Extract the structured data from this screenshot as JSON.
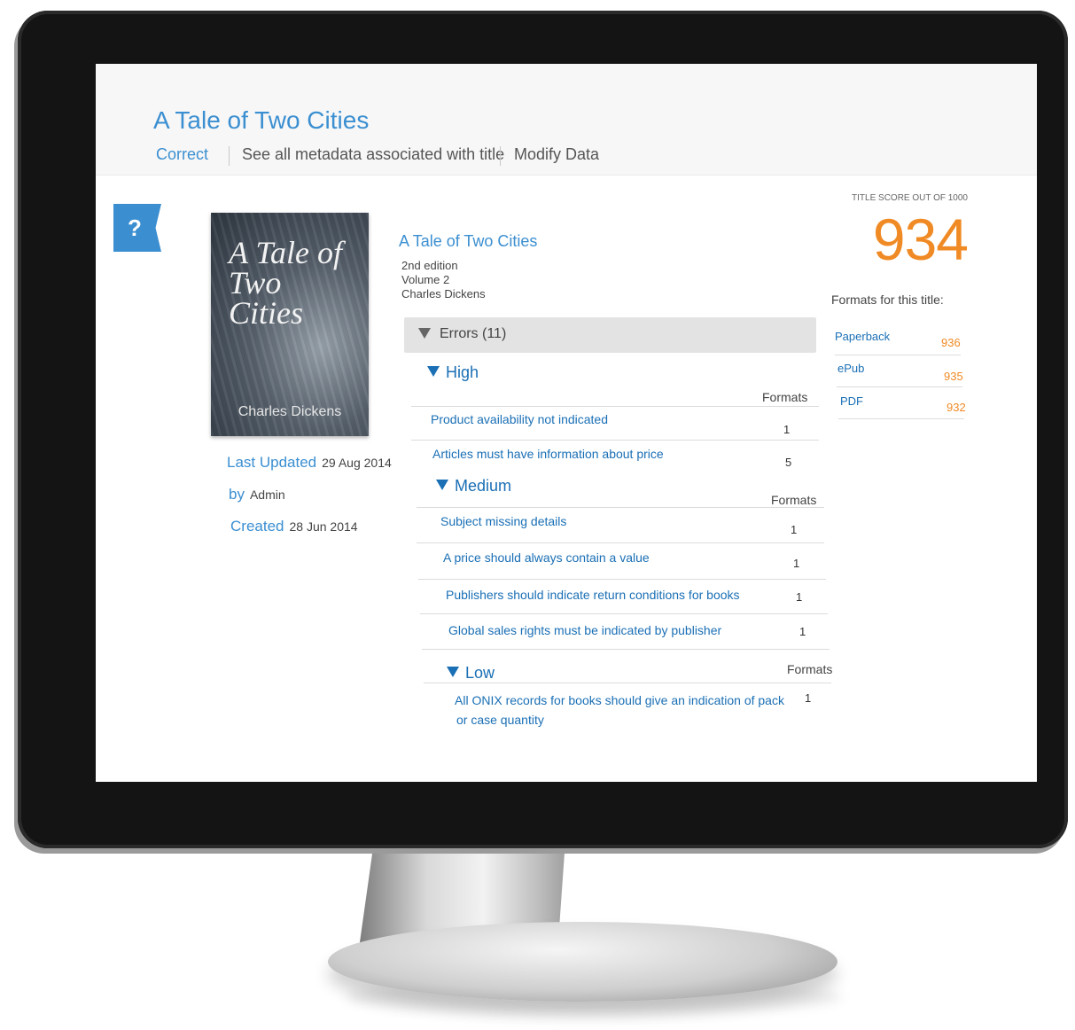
{
  "title": {
    "text": "A Tale of Two Cities"
  },
  "nav": {
    "correct": "Correct",
    "see_all": "See all metadata associated with title",
    "modify": "Modify Data"
  },
  "help": {
    "glyph": "?"
  },
  "cover": {
    "title": "A Tale of Two Cities",
    "author": "Charles Dickens"
  },
  "info": {
    "last_updated_label": "Last Updated",
    "last_updated_value": "29 Aug 2014",
    "by_label": "by",
    "by_value": "Admin",
    "created_label": "Created",
    "created_value": "28 Jun 2014"
  },
  "book": {
    "title": "A Tale of Two Cities",
    "edition": "2nd edition",
    "volume": "Volume 2",
    "author": "Charles Dickens"
  },
  "errors": {
    "label": "Errors (11)",
    "formats_header": "Formats",
    "high": {
      "label": "High",
      "items": [
        {
          "text": "Product availability not indicated",
          "count": "1"
        },
        {
          "text": "Articles must have information about price",
          "count": "5"
        }
      ]
    },
    "medium": {
      "label": "Medium",
      "items": [
        {
          "text": "Subject missing details",
          "count": "1"
        },
        {
          "text": "A price should always contain a value",
          "count": "1"
        },
        {
          "text": "Publishers should indicate return conditions for books",
          "count": "1"
        },
        {
          "text": "Global sales rights must be indicated by publisher",
          "count": "1"
        }
      ]
    },
    "low": {
      "label": "Low",
      "items": [
        {
          "text_line1": "All ONIX records for books should give an indication of pack",
          "text_line2": "or case quantity",
          "count": "1"
        }
      ]
    }
  },
  "score": {
    "label": "TITLE SCORE OUT OF 1000",
    "value": "934"
  },
  "formats": {
    "header": "Formats for this title:",
    "items": [
      {
        "name": "Paperback",
        "score": "936"
      },
      {
        "name": "ePub",
        "score": "935"
      },
      {
        "name": "PDF",
        "score": "932"
      }
    ]
  },
  "colors": {
    "accent": "#3b8fd1",
    "link": "#1a6fb5",
    "score": "#f08a24"
  }
}
